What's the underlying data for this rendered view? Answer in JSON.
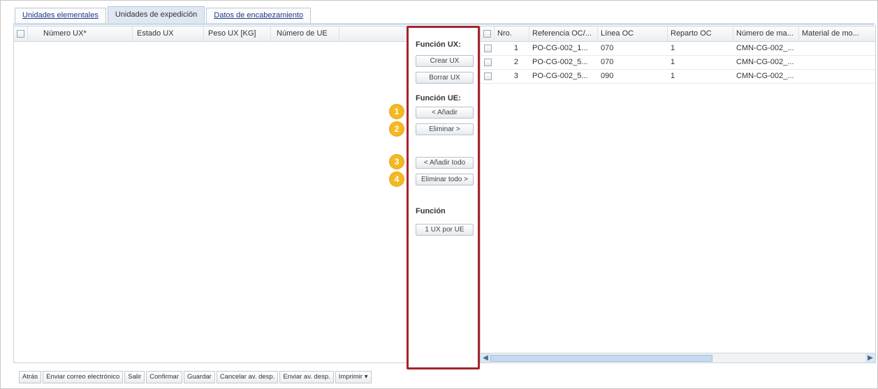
{
  "tabs": [
    {
      "label": "Unidades elementales",
      "active": false
    },
    {
      "label": "Unidades de expedición",
      "active": true
    },
    {
      "label": "Datos de encabezamiento",
      "active": false
    }
  ],
  "left_grid": {
    "columns": [
      "Número UX*",
      "Estado UX",
      "Peso UX [KG]",
      "Número de UE"
    ]
  },
  "functions": {
    "ux_title": "Función UX:",
    "crear_ux": "Crear UX",
    "borrar_ux": "Borrar UX",
    "ue_title": "Función UE:",
    "anadir": "< Añadir",
    "eliminar": "Eliminar >",
    "anadir_todo": "< Añadir todo",
    "eliminar_todo": "Eliminar todo >",
    "func_title": "Función",
    "ux_por_ue": "1 UX por UE",
    "badges": [
      "1",
      "2",
      "3",
      "4"
    ]
  },
  "right_grid": {
    "columns": [
      "Nro.",
      "Referencia OC/...",
      "Línea OC",
      "Reparto OC",
      "Número de ma...",
      "Material de mo..."
    ],
    "rows": [
      {
        "nro": "1",
        "ref": "PO-CG-002_1...",
        "linea": "070",
        "reparto": "1",
        "numero": "CMN-CG-002_...",
        "material": ""
      },
      {
        "nro": "2",
        "ref": "PO-CG-002_5...",
        "linea": "070",
        "reparto": "1",
        "numero": "CMN-CG-002_...",
        "material": ""
      },
      {
        "nro": "3",
        "ref": "PO-CG-002_5...",
        "linea": "090",
        "reparto": "1",
        "numero": "CMN-CG-002_...",
        "material": ""
      }
    ]
  },
  "toolbar": {
    "atras": "Atrás",
    "enviar_correo": "Enviar correo electrónico",
    "salir": "Salir",
    "confirmar": "Confirmar",
    "guardar": "Guardar",
    "cancelar": "Cancelar av. desp.",
    "enviar_av": "Enviar av. desp.",
    "imprimir": "Imprimir",
    "imprimir_arrow": "▾"
  },
  "colors": {
    "highlight_border": "#a4232c",
    "badge": "#f3b823",
    "active_tab": "#dfe8f2",
    "scroll_thumb": "#c7daf0"
  },
  "icons": {
    "scroll_left": "◀",
    "scroll_right": "▶"
  }
}
